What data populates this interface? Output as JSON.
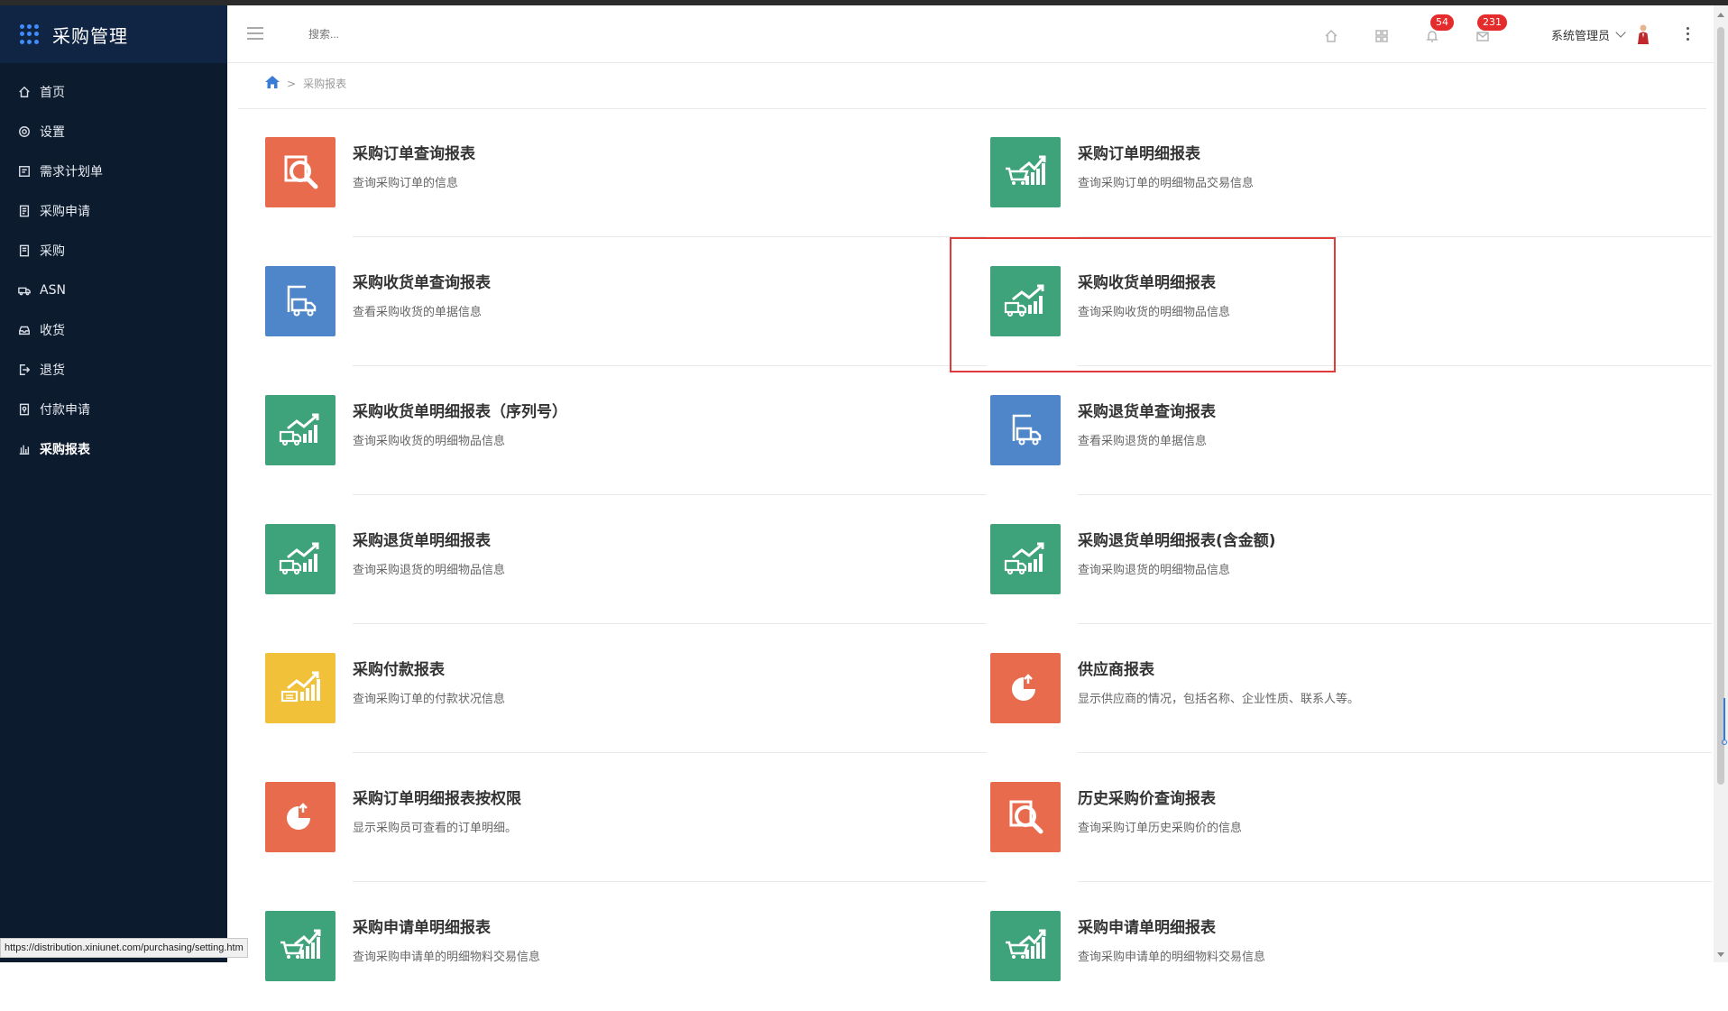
{
  "sidebar": {
    "title": "采购管理",
    "items": [
      {
        "label": "首页",
        "icon": "home-icon"
      },
      {
        "label": "设置",
        "icon": "gear-icon"
      },
      {
        "label": "需求计划单",
        "icon": "note-icon"
      },
      {
        "label": "采购申请",
        "icon": "doc-icon"
      },
      {
        "label": "采购",
        "icon": "list-icon"
      },
      {
        "label": "ASN",
        "icon": "truck-icon"
      },
      {
        "label": "收货",
        "icon": "inbox-icon"
      },
      {
        "label": "退货",
        "icon": "return-icon"
      },
      {
        "label": "付款申请",
        "icon": "pay-icon"
      },
      {
        "label": "采购报表",
        "icon": "bar-chart-icon"
      }
    ],
    "active": "采购报表"
  },
  "header": {
    "search_placeholder": "搜索...",
    "notifications_count": "54",
    "messages_count": "231",
    "user_name": "系统管理员"
  },
  "breadcrumb": {
    "current": "采购报表"
  },
  "reports": [
    {
      "title": "采购订单查询报表",
      "desc": "查询采购订单的信息",
      "color": "#e86b4e",
      "icon": "magnifier-icon"
    },
    {
      "title": "采购订单明细报表",
      "desc": "查询采购订单的明细物品交易信息",
      "color": "#3ea37a",
      "icon": "cart-chart-icon"
    },
    {
      "title": "采购收货单查询报表",
      "desc": "查看采购收货的单据信息",
      "color": "#4f86c9",
      "icon": "truck-doc-icon"
    },
    {
      "title": "采购收货单明细报表",
      "desc": "查询采购收货的明细物品信息",
      "color": "#3ea37a",
      "icon": "truck-chart-icon"
    },
    {
      "title": "采购收货单明细报表（序列号）",
      "desc": "查询采购收货的明细物品信息",
      "color": "#3ea37a",
      "icon": "truck-chart-icon"
    },
    {
      "title": "采购退货单查询报表",
      "desc": "查看采购退货的单据信息",
      "color": "#4f86c9",
      "icon": "truck-doc-icon"
    },
    {
      "title": "采购退货单明细报表",
      "desc": "查询采购退货的明细物品信息",
      "color": "#3ea37a",
      "icon": "truck-chart-icon"
    },
    {
      "title": "采购退货单明细报表(含金额)",
      "desc": "查询采购退货的明细物品信息",
      "color": "#3ea37a",
      "icon": "truck-chart-icon"
    },
    {
      "title": "采购付款报表",
      "desc": "查询采购订单的付款状况信息",
      "color": "#f2c13a",
      "icon": "coin-chart-icon"
    },
    {
      "title": "供应商报表",
      "desc": "显示供应商的情况，包括名称、企业性质、联系人等。",
      "color": "#e86b4e",
      "icon": "pie-chart-icon"
    },
    {
      "title": "采购订单明细报表按权限",
      "desc": "显示采购员可查看的订单明细。",
      "color": "#e86b4e",
      "icon": "pie-chart-icon"
    },
    {
      "title": "历史采购价查询报表",
      "desc": "查询采购订单历史采购价的信息",
      "color": "#e86b4e",
      "icon": "magnifier-icon"
    },
    {
      "title": "采购申请单明细报表",
      "desc": "查询采购申请单的明细物料交易信息",
      "color": "#3ea37a",
      "icon": "cart-chart-icon"
    },
    {
      "title": "采购申请单明细报表",
      "desc": "查询采购申请单的明细物料交易信息",
      "color": "#3ea37a",
      "icon": "cart-chart-icon"
    }
  ],
  "status_url": "https://distribution.xiniunet.com/purchasing/setting.htm"
}
